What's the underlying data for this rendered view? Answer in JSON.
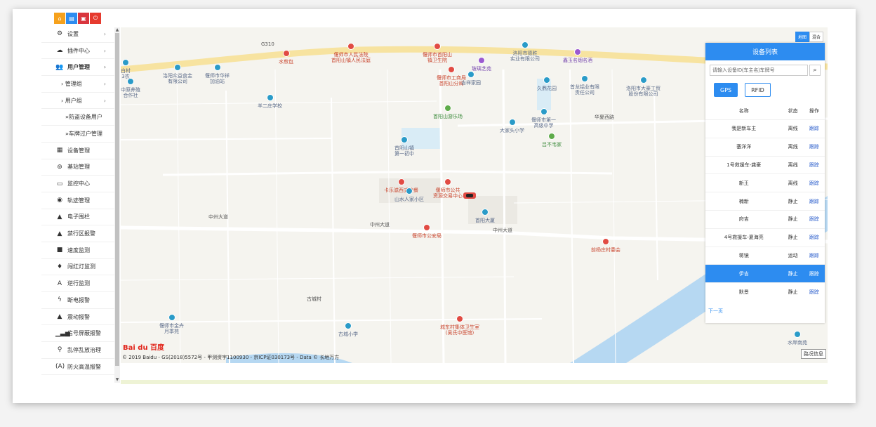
{
  "toolbar": {
    "buttons": [
      {
        "name": "home",
        "glyph": "⌂"
      },
      {
        "name": "doc",
        "glyph": "▤"
      },
      {
        "name": "lock",
        "glyph": "▣"
      },
      {
        "name": "power",
        "glyph": "⏻"
      }
    ]
  },
  "sidebar": {
    "items": [
      {
        "label": "设置",
        "icon": "gear-icon",
        "glyph": "⚙",
        "chevron": "›",
        "level": 0
      },
      {
        "label": "插件中心",
        "icon": "cloud-icon",
        "glyph": "☁",
        "chevron": "›",
        "level": 0
      },
      {
        "label": "用户管理",
        "icon": "users-icon",
        "glyph": "👥",
        "chevron": "›",
        "level": 0,
        "bold": true
      },
      {
        "label": "› 管理组",
        "icon": "",
        "glyph": "",
        "chevron": "›",
        "level": 1
      },
      {
        "label": "› 用户组",
        "icon": "",
        "glyph": "",
        "chevron": "›",
        "level": 1
      },
      {
        "label": "»防盗设备用户",
        "icon": "",
        "glyph": "",
        "chevron": "",
        "level": 2
      },
      {
        "label": "»车牌过户管理",
        "icon": "",
        "glyph": "",
        "chevron": "",
        "level": 2
      },
      {
        "label": "设备管理",
        "icon": "device-icon",
        "glyph": "▦",
        "chevron": "",
        "level": 0
      },
      {
        "label": "基站管理",
        "icon": "tower-icon",
        "glyph": "⊚",
        "chevron": "",
        "level": 0
      },
      {
        "label": "监控中心",
        "icon": "monitor-icon",
        "glyph": "▭",
        "chevron": "",
        "level": 0
      },
      {
        "label": "轨迹管理",
        "icon": "track-icon",
        "glyph": "◉",
        "chevron": "",
        "level": 0
      },
      {
        "label": "电子围栏",
        "icon": "lock-icon",
        "glyph": "▲",
        "chevron": "",
        "level": 0
      },
      {
        "label": "禁行区报警",
        "icon": "bell-icon",
        "glyph": "▲",
        "chevron": "",
        "level": 0
      },
      {
        "label": "速度监测",
        "icon": "video-icon",
        "glyph": "■",
        "chevron": "",
        "level": 0
      },
      {
        "label": "闯红灯监测",
        "icon": "pin-icon",
        "glyph": "♦",
        "chevron": "",
        "level": 0
      },
      {
        "label": "逆行监测",
        "icon": "road-icon",
        "glyph": "A",
        "chevron": "",
        "level": 0
      },
      {
        "label": "断电报警",
        "icon": "bolt-icon",
        "glyph": "ϟ",
        "chevron": "",
        "level": 0
      },
      {
        "label": "震动报警",
        "icon": "bell-icon",
        "glyph": "▲",
        "chevron": "",
        "level": 0
      },
      {
        "label": "信号屏蔽报警",
        "icon": "signal-icon",
        "glyph": "▁▃▅",
        "chevron": "",
        "level": 0
      },
      {
        "label": "乱停乱放治理",
        "icon": "bike-icon",
        "glyph": "⚲",
        "chevron": "",
        "level": 0
      },
      {
        "label": "防火高温报警",
        "icon": "fire-icon",
        "glyph": "(A)",
        "chevron": "",
        "level": 0
      }
    ]
  },
  "map": {
    "type_buttons": [
      "地图",
      "混合"
    ],
    "copyright": "© 2019 Baidu - GS(2018)5572号 - 甲测资字1100930 - 京ICP证030173号 - Data © 长地万方",
    "logo": "Bai du 百度",
    "traffic": "路况信息",
    "pois": [
      {
        "text": "偃师市人民法院\n首阳山镇人民法庭",
        "color": "red"
      },
      {
        "text": "偃师市首阳山\n镇卫生院",
        "color": "red"
      },
      {
        "text": "洛阳市德胜\n实业有限公司",
        "color": "blue"
      },
      {
        "text": "鑫玉名烟名酒",
        "color": "purple"
      },
      {
        "text": "水煎包",
        "color": "red"
      },
      {
        "text": "玻璃艺苑",
        "color": "purple"
      },
      {
        "text": "洛阳众益食金\n有限公司",
        "color": "blue"
      },
      {
        "text": "偃师市华祥\n加油站",
        "color": "blue"
      },
      {
        "text": "偃师市工商局\n首阳山分局",
        "color": "red"
      },
      {
        "text": "吉祥家园",
        "color": "blue"
      },
      {
        "text": "久鼎花园",
        "color": "blue"
      },
      {
        "text": "首龙铝业有限\n责任公司",
        "color": "blue"
      },
      {
        "text": "洛阳市大豪工贸\n股份有限公司",
        "color": "blue"
      },
      {
        "text": "羊二庄学校",
        "color": "blue"
      },
      {
        "text": "首阳山游乐场",
        "color": "green"
      },
      {
        "text": "偃师市第一\n高级中学",
        "color": "blue"
      },
      {
        "text": "大家头小学",
        "color": "blue"
      },
      {
        "text": "吕不韦家",
        "color": "green"
      },
      {
        "text": "首阳山镇\n第一初中",
        "color": "blue"
      },
      {
        "text": "卡乐滋西式快餐",
        "color": "red"
      },
      {
        "text": "偃师市公共\n资源交易中心",
        "color": "red"
      },
      {
        "text": "山水人家小区",
        "color": "blue"
      },
      {
        "text": "首阳大厦",
        "color": "blue"
      },
      {
        "text": "偃师市公安局",
        "color": "red"
      },
      {
        "text": "前杨庄村委会",
        "color": "red"
      },
      {
        "text": "偃师市金卉\n月季苑",
        "color": "blue"
      },
      {
        "text": "古城小学",
        "color": "blue"
      },
      {
        "text": "城东村集体卫生室\n(吴氏中医馆)",
        "color": "red"
      },
      {
        "text": "水岸南苑",
        "color": "blue"
      },
      {
        "text": "中原养殖\n合作社",
        "color": "blue"
      },
      {
        "text": "白村\n3农",
        "color": "blue"
      }
    ],
    "road_labels": [
      "中州大道",
      "中州大道",
      "中州大道",
      "华夏西路",
      "古城村",
      "G310"
    ]
  },
  "panel": {
    "title": "设备列表",
    "search_placeholder": "请输入设备ID(车主名)车牌号",
    "type_buttons": [
      "GPS",
      "RFID"
    ],
    "columns": [
      "名称",
      "状态",
      "操作"
    ],
    "rows": [
      {
        "name": "我是新车主",
        "status": "离线",
        "op": "跟踪"
      },
      {
        "name": "塞洋洋",
        "status": "离线",
        "op": "跟踪"
      },
      {
        "name": "1号救援车-龚豪",
        "status": "离线",
        "op": "跟踪"
      },
      {
        "name": "新王",
        "status": "离线",
        "op": "跟踪"
      },
      {
        "name": "楠新",
        "status": "静止",
        "op": "跟踪"
      },
      {
        "name": "府吉",
        "status": "静止",
        "op": "跟踪"
      },
      {
        "name": "4号救援车-夏海亮",
        "status": "静止",
        "op": "跟踪"
      },
      {
        "name": "蒋镜",
        "status": "运动",
        "op": "跟踪"
      },
      {
        "name": "伊吉",
        "status": "静止",
        "op": "跟踪",
        "selected": true
      },
      {
        "name": "默景",
        "status": "静止",
        "op": "跟踪"
      }
    ],
    "next_page": "下一页"
  }
}
